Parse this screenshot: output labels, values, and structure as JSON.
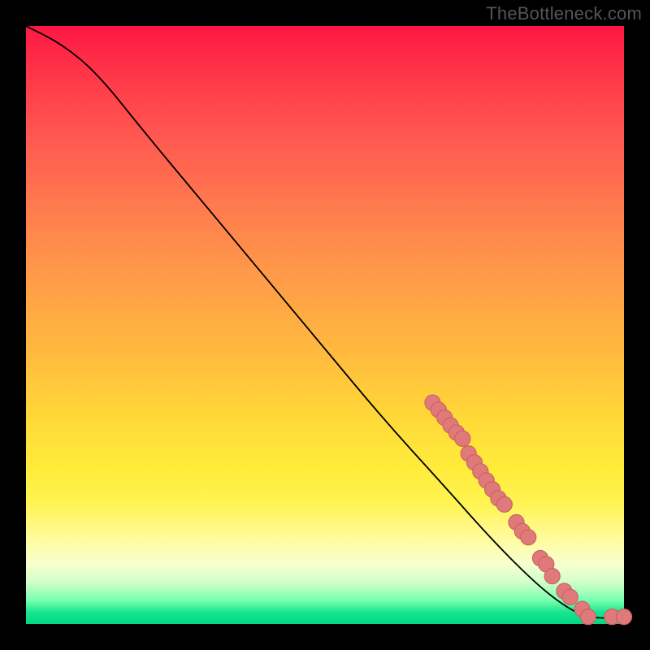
{
  "watermark": "TheBottleneck.com",
  "colors": {
    "point_fill": "#e07a7a",
    "point_stroke": "#c96060",
    "curve": "#000000"
  },
  "chart_data": {
    "type": "line",
    "title": "",
    "xlabel": "",
    "ylabel": "",
    "xlim": [
      0,
      100
    ],
    "ylim": [
      0,
      100
    ],
    "curve": [
      {
        "x": 0,
        "y": 100
      },
      {
        "x": 6,
        "y": 97
      },
      {
        "x": 12,
        "y": 92
      },
      {
        "x": 20,
        "y": 82
      },
      {
        "x": 30,
        "y": 70
      },
      {
        "x": 40,
        "y": 58
      },
      {
        "x": 50,
        "y": 46
      },
      {
        "x": 60,
        "y": 34
      },
      {
        "x": 70,
        "y": 23
      },
      {
        "x": 78,
        "y": 14
      },
      {
        "x": 85,
        "y": 7
      },
      {
        "x": 90,
        "y": 3
      },
      {
        "x": 94,
        "y": 1
      },
      {
        "x": 100,
        "y": 1
      }
    ],
    "series": [
      {
        "name": "points",
        "values": [
          {
            "x": 68,
            "y": 37
          },
          {
            "x": 69,
            "y": 35.8
          },
          {
            "x": 70,
            "y": 34.5
          },
          {
            "x": 71,
            "y": 33.2
          },
          {
            "x": 72,
            "y": 32
          },
          {
            "x": 73,
            "y": 31
          },
          {
            "x": 74,
            "y": 28.5
          },
          {
            "x": 75,
            "y": 27
          },
          {
            "x": 76,
            "y": 25.5
          },
          {
            "x": 77,
            "y": 24
          },
          {
            "x": 78,
            "y": 22.5
          },
          {
            "x": 79,
            "y": 21
          },
          {
            "x": 80,
            "y": 20
          },
          {
            "x": 82,
            "y": 17
          },
          {
            "x": 83,
            "y": 15.5
          },
          {
            "x": 84,
            "y": 14.5
          },
          {
            "x": 86,
            "y": 11
          },
          {
            "x": 87,
            "y": 10
          },
          {
            "x": 88,
            "y": 8
          },
          {
            "x": 90,
            "y": 5.5
          },
          {
            "x": 91,
            "y": 4.5
          },
          {
            "x": 93,
            "y": 2.5
          },
          {
            "x": 94,
            "y": 1.2
          },
          {
            "x": 98,
            "y": 1.2
          },
          {
            "x": 100,
            "y": 1.2
          }
        ]
      }
    ]
  }
}
